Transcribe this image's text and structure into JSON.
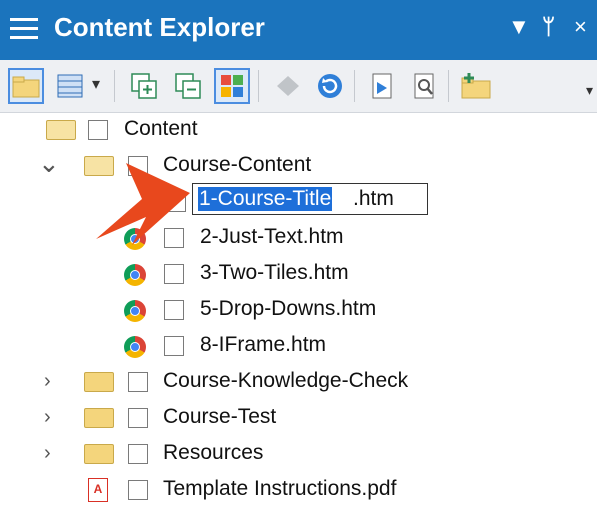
{
  "window": {
    "title": "Content Explorer",
    "menu_icon": "hamburger-icon",
    "dropdown_glyph": "▼",
    "pin_glyph": "ᛘ",
    "close_glyph": "×"
  },
  "toolbar": {
    "icons": [
      "new-folder-icon",
      "view-table-icon",
      "expand-all-icon",
      "collapse-all-icon",
      "thumbnail-view-icon",
      "disabled-import-icon",
      "refresh-icon",
      "open-file-icon",
      "properties-icon",
      "add-folder-icon"
    ],
    "dropdown_glyph": "▾"
  },
  "tree": {
    "root_label": "Content",
    "course_content_label": "Course-Content",
    "editing": {
      "selected_text": "1-Course-Title",
      "rest_text": ".htm"
    },
    "files": [
      "2-Just-Text.htm",
      "3-Two-Tiles.htm",
      "5-Drop-Downs.htm",
      "8-IFrame.htm"
    ],
    "knowledge_check_label": "Course-Knowledge-Check",
    "course_test_label": "Course-Test",
    "resources_label": "Resources",
    "pdf_label": "Template Instructions.pdf",
    "pdf_badge": "A",
    "expanded_glyph": "⌄",
    "collapsed_glyph": "›"
  },
  "colors": {
    "titlebar": "#1b74bd",
    "selection": "#1e6fd9",
    "arrow": "#e8481d"
  }
}
